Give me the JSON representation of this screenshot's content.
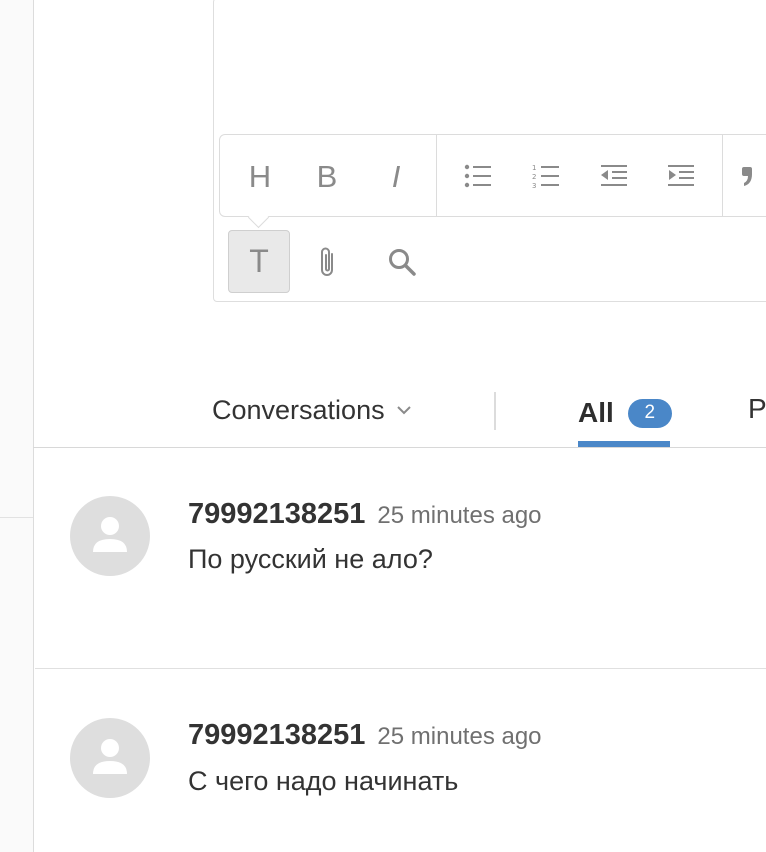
{
  "toolbar": {
    "heading_label": "H",
    "bold_label": "B",
    "italic_label": "I",
    "text_label": "T"
  },
  "tabs": {
    "dropdown_label": "Conversations",
    "all_label": "All",
    "all_count": "2",
    "next_label_partial": "P"
  },
  "messages": [
    {
      "author": "79992138251",
      "time": "25 minutes ago",
      "text": "По русский не ало?"
    },
    {
      "author": "79992138251",
      "time": "25 minutes ago",
      "text": "С чего надо начинать"
    }
  ],
  "colors": {
    "accent": "#4a87c8",
    "avatar": "#dedede",
    "icon": "#8a8a8a"
  }
}
